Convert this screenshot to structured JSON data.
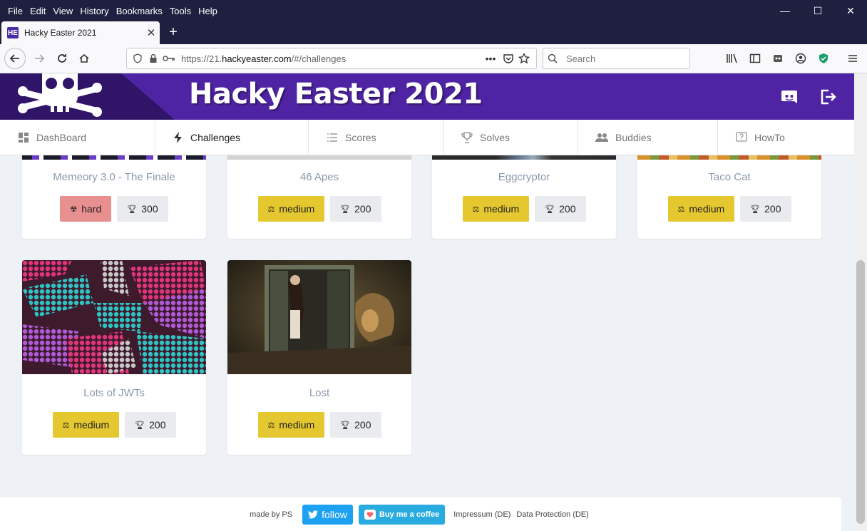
{
  "window": {
    "menu": [
      "File",
      "Edit",
      "View",
      "History",
      "Bookmarks",
      "Tools",
      "Help"
    ],
    "controls": {
      "minimize": "—",
      "maximize": "☐",
      "close": "✕"
    }
  },
  "tab": {
    "title": "Hacky Easter 2021",
    "favicon": "HE"
  },
  "toolbar": {
    "url_prefix": "https://21.",
    "url_domain": "hackyeaster.com",
    "url_path": "/#/challenges",
    "search_placeholder": "Search",
    "page_actions": "•••"
  },
  "site": {
    "title": "Hacky Easter 2021",
    "nav": [
      {
        "label": "DashBoard",
        "icon": "dashboard-icon"
      },
      {
        "label": "Challenges",
        "icon": "bolt-icon"
      },
      {
        "label": "Scores",
        "icon": "list-icon"
      },
      {
        "label": "Solves",
        "icon": "trophy-icon"
      },
      {
        "label": "Buddies",
        "icon": "people-icon"
      },
      {
        "label": "HowTo",
        "icon": "help-icon"
      }
    ]
  },
  "challenges": [
    {
      "title": "Memeory 3.0 - The Finale",
      "level": "hard",
      "points": "300"
    },
    {
      "title": "46 Apes",
      "level": "medium",
      "points": "200"
    },
    {
      "title": "Eggcryptor",
      "level": "medium",
      "points": "200"
    },
    {
      "title": "Taco Cat",
      "level": "medium",
      "points": "200"
    },
    {
      "title": "Lots of JWTs",
      "level": "medium",
      "points": "200"
    },
    {
      "title": "Lost",
      "level": "medium",
      "points": "200"
    }
  ],
  "footer": {
    "made_by": "made by PS",
    "follow": "follow",
    "coffee": "Buy me a coffee",
    "impressum": "Impressum (DE)",
    "data_protection": "Data Protection (DE)"
  },
  "colors": {
    "brand": "#4f24a4",
    "medium": "#e5c830",
    "hard": "#e88f8f"
  }
}
